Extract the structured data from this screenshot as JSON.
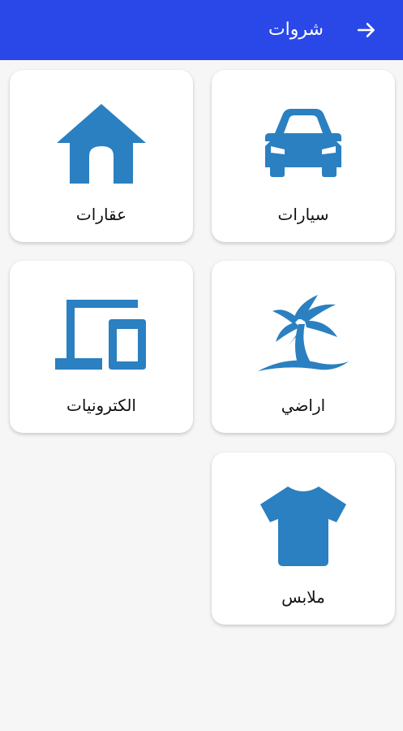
{
  "appbar": {
    "title": "شروات",
    "back_icon": "arrow-right-icon",
    "background": "#2a48e8"
  },
  "categories": [
    {
      "label": "سيارات",
      "icon": "car-icon"
    },
    {
      "label": "عقارات",
      "icon": "house-icon"
    },
    {
      "label": "اراضي",
      "icon": "palm-island-icon"
    },
    {
      "label": "الكترونيات",
      "icon": "devices-icon"
    },
    {
      "label": "ملابس",
      "icon": "tshirt-icon"
    }
  ],
  "colors": {
    "icon": "#2a80c0",
    "card": "#ffffff",
    "background": "#f6f6f6"
  }
}
